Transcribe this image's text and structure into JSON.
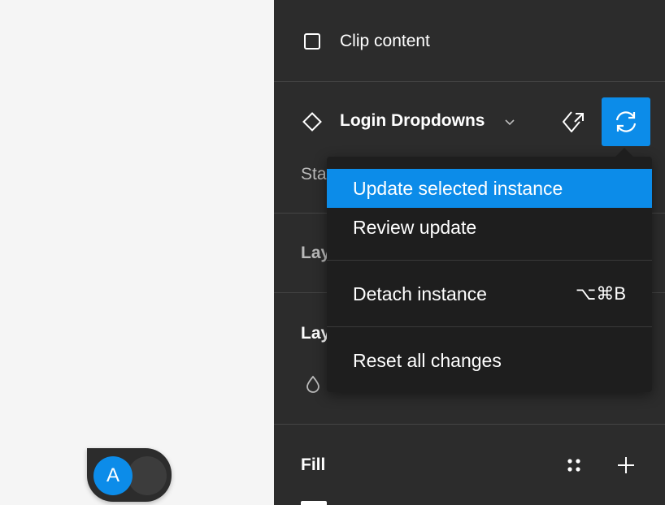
{
  "multiplayer": {
    "avatar_initial": "A"
  },
  "panel": {
    "clip_content_label": "Clip content",
    "component": {
      "name": "Login Dropdowns",
      "icon": "component-diamond-icon",
      "goto_icon": "go-to-main-component-icon",
      "update_icon": "sync-update-icon"
    },
    "partial_labels": {
      "status": "Sta",
      "layer_1": "Lay",
      "layer_2": "Lay"
    },
    "fill": {
      "title": "Fill",
      "styles_icon": "styles-grid-icon",
      "add_icon": "plus-icon"
    }
  },
  "menu": {
    "items": [
      {
        "label": "Update selected instance",
        "active": true
      },
      {
        "label": "Review update"
      },
      {
        "label": "Detach instance",
        "shortcut": "⌥⌘B"
      },
      {
        "label": "Reset all changes"
      }
    ]
  },
  "colors": {
    "accent": "#0c8ce9",
    "panel_bg": "#2c2c2c",
    "menu_bg": "#1e1e1e",
    "canvas_bg": "#f5f5f5"
  }
}
